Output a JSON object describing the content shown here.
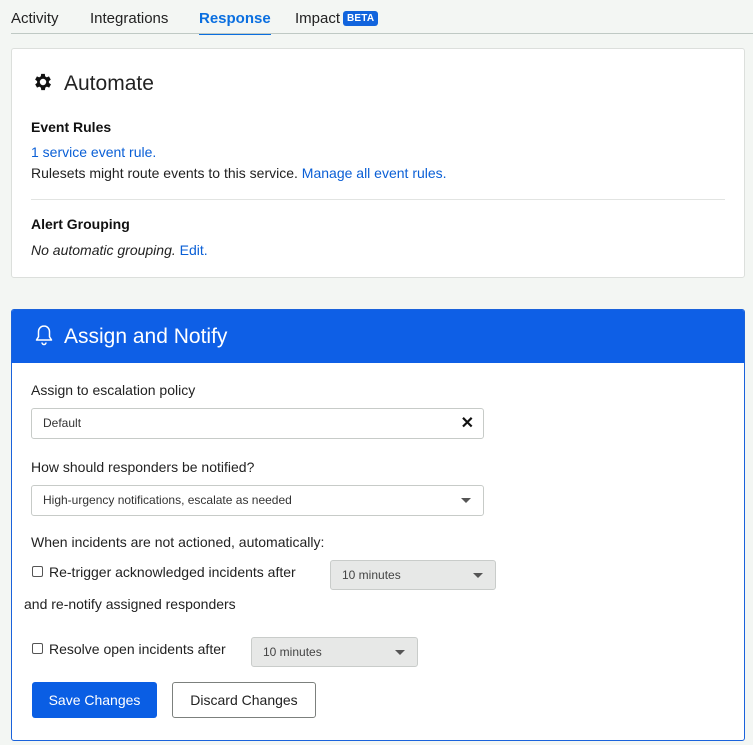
{
  "tabs": [
    {
      "label": "Activity"
    },
    {
      "label": "Integrations"
    },
    {
      "label": "Response",
      "active": true
    },
    {
      "label": "Impact",
      "badge": "BETA"
    }
  ],
  "automate": {
    "title": "Automate",
    "icon": "gear-icon",
    "event_rules": {
      "title": "Event Rules",
      "link": "1 service event rule.",
      "note": "Rulesets might route events to this service.",
      "manage_link": "Manage all event rules."
    },
    "alert_grouping": {
      "title": "Alert Grouping",
      "status": "No automatic grouping.",
      "edit_link": "Edit."
    }
  },
  "assign": {
    "title": "Assign and Notify",
    "icon": "bell-icon",
    "header_color": "#0e5fe6",
    "policy_label": "Assign to escalation policy",
    "policy_value": "Default",
    "notify_label": "How should responders be notified?",
    "notify_value": "High-urgency notifications, escalate as needed",
    "not_actioned_label": "When incidents are not actioned, automatically:",
    "retrigger_label": "Re-trigger acknowledged incidents after",
    "retrigger_value": "10 minutes",
    "renotify_label": "and re-notify assigned responders",
    "resolve_label": "Resolve open incidents after",
    "resolve_value": "10 minutes",
    "save_label": "Save Changes",
    "discard_label": "Discard Changes"
  }
}
